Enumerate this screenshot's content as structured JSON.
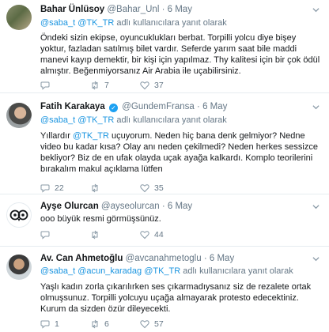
{
  "tweets": [
    {
      "name": "Bahar Ünlüsoy",
      "handle": "@Bahar_Unl",
      "time": "6 May",
      "reply_to_a": "@saba_t",
      "reply_to_b": "@TK_TR",
      "reply_suffix": "adlı kullanıcılara yanıt olarak",
      "body": "Öndeki sizin ekipse, oyuncuklukları berbat. Torpilli yolcu diye bişey yoktur, fazladan satılmış bilet vardır. Seferde yarım saat bile maddi manevi kayıp demektir, bir kişi için yapılmaz. Thy kalitesi için bir çok ödül almıştır. Beğenmiyorsanız Air Arabia ile uçabilirsiniz.",
      "replies": "",
      "retweets": "7",
      "likes": "37"
    },
    {
      "name": "Fatih Karakaya",
      "handle": "@GundemFransa",
      "time": "6 May",
      "reply_to_a": "@saba_t",
      "reply_to_b": "@TK_TR",
      "reply_suffix": "adlı kullanıcılara yanıt olarak",
      "body_prefix": "Yıllardır ",
      "body_mention": "@TK_TR",
      "body": " uçuyorum. Neden hiç bana denk gelmiyor? Nedne video bu kadar kısa? Olay anı neden çekilmedi? Neden herkes sessizce bekliyor? Biz de en ufak olayda uçak ayağa kalkardı. Komplo teorilerini bırakalım makul açıklama lütfen",
      "replies": "22",
      "retweets": "",
      "likes": "35"
    },
    {
      "name": "Ayşe Olurcan",
      "handle": "@ayseolurcan",
      "time": "6 May",
      "body": "ooo büyük resmi görmüşsünüz.",
      "replies": "",
      "retweets": "",
      "likes": "44"
    },
    {
      "name": "Av. Can Ahmetoğlu",
      "handle": "@avcanahmetoglu",
      "time": "6 May",
      "reply_to_a": "@saba_t",
      "reply_to_b": "@acun_karadag",
      "reply_to_more": "@TK_TR",
      "reply_suffix": "adlı kullanıcılara yanıt olarak",
      "body": "Yaşlı kadın zorla çıkarılırken ses çıkarmadıysanız siz de rezalete ortak olmuşsunuz. Torpilli yolcuyu uçağa almayarak protesto edecektiniz. Kurum da sizden özür dileyecekti.",
      "replies": "1",
      "retweets": "6",
      "likes": "57"
    }
  ],
  "separator": "·",
  "colors": {
    "link": "#1b95e0",
    "muted": "#657786",
    "verified": "#1da1f2"
  }
}
